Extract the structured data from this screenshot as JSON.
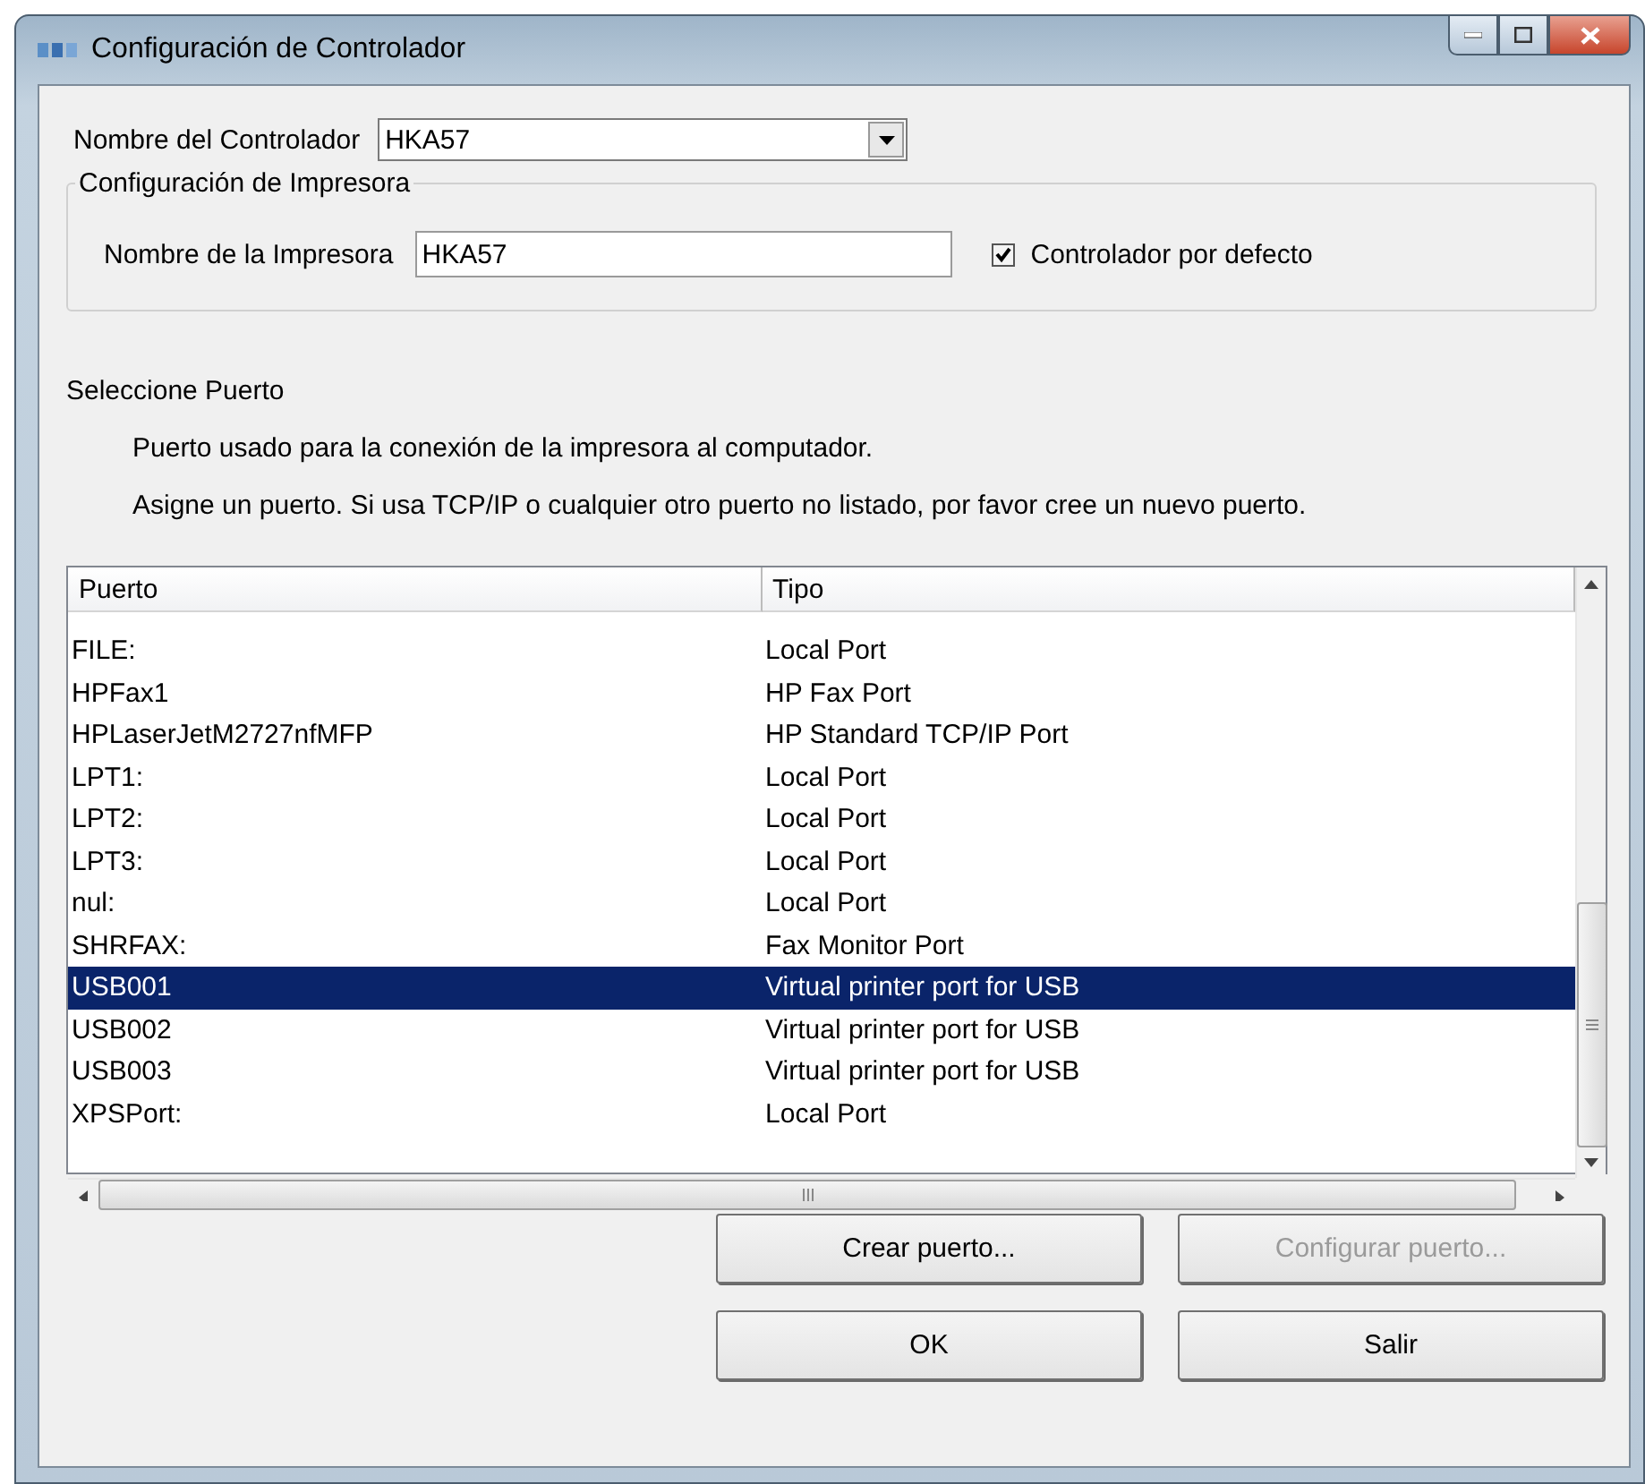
{
  "window": {
    "title": "Configuración de Controlador"
  },
  "controller_name": {
    "label": "Nombre del Controlador",
    "value": "HKA57"
  },
  "printer_group": {
    "legend": "Configuración de Impresora",
    "printer_name": {
      "label": "Nombre de la Impresora",
      "value": "HKA57"
    },
    "default_checkbox": {
      "label": "Controlador por defecto",
      "checked": true
    }
  },
  "port_section": {
    "heading": "Seleccione Puerto",
    "lines": [
      "Puerto usado para la conexión de la impresora al computador.",
      "Asigne un puerto. Si usa TCP/IP o cualquier otro puerto no listado, por favor cree un nuevo puerto."
    ]
  },
  "port_table": {
    "columns": [
      "Puerto",
      "Tipo"
    ],
    "rows": [
      {
        "port": "FILE:",
        "type": "Local Port",
        "selected": false
      },
      {
        "port": "HPFax1",
        "type": "HP Fax Port",
        "selected": false
      },
      {
        "port": "HPLaserJetM2727nfMFP",
        "type": "HP Standard TCP/IP Port",
        "selected": false
      },
      {
        "port": "LPT1:",
        "type": "Local Port",
        "selected": false
      },
      {
        "port": "LPT2:",
        "type": "Local Port",
        "selected": false
      },
      {
        "port": "LPT3:",
        "type": "Local Port",
        "selected": false
      },
      {
        "port": "nul:",
        "type": "Local Port",
        "selected": false
      },
      {
        "port": "SHRFAX:",
        "type": "Fax Monitor Port",
        "selected": false
      },
      {
        "port": "USB001",
        "type": "Virtual printer port for USB",
        "selected": true
      },
      {
        "port": "USB002",
        "type": "Virtual printer port for USB",
        "selected": false
      },
      {
        "port": "USB003",
        "type": "Virtual printer port for USB",
        "selected": false
      },
      {
        "port": "XPSPort:",
        "type": "Local Port",
        "selected": false
      }
    ]
  },
  "buttons": [
    {
      "label": "Crear puerto...",
      "disabled": false
    },
    {
      "label": "Configurar puerto...",
      "disabled": true
    },
    {
      "label": "OK",
      "disabled": false
    },
    {
      "label": "Salir",
      "disabled": false
    }
  ]
}
